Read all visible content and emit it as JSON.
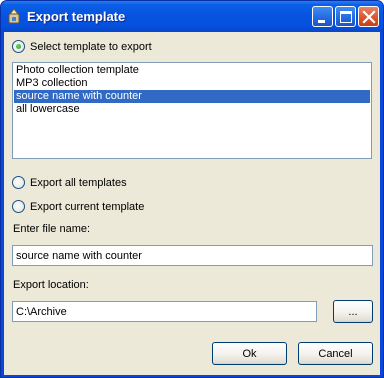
{
  "window": {
    "title": "Export template"
  },
  "options": {
    "select_template": "Select template to export",
    "export_all": "Export all templates",
    "export_current": "Export current template",
    "selected": "select_template"
  },
  "templates": {
    "items": [
      {
        "label": "Photo collection template"
      },
      {
        "label": "MP3 collection"
      },
      {
        "label": "source name with counter"
      },
      {
        "label": "all lowercase"
      }
    ],
    "selected_index": 2
  },
  "file_name": {
    "label": "Enter file name:",
    "value": "source name with counter"
  },
  "export_location": {
    "label": "Export location:",
    "value": "C:\\Archive",
    "browse_label": "..."
  },
  "buttons": {
    "ok": "Ok",
    "cancel": "Cancel"
  }
}
